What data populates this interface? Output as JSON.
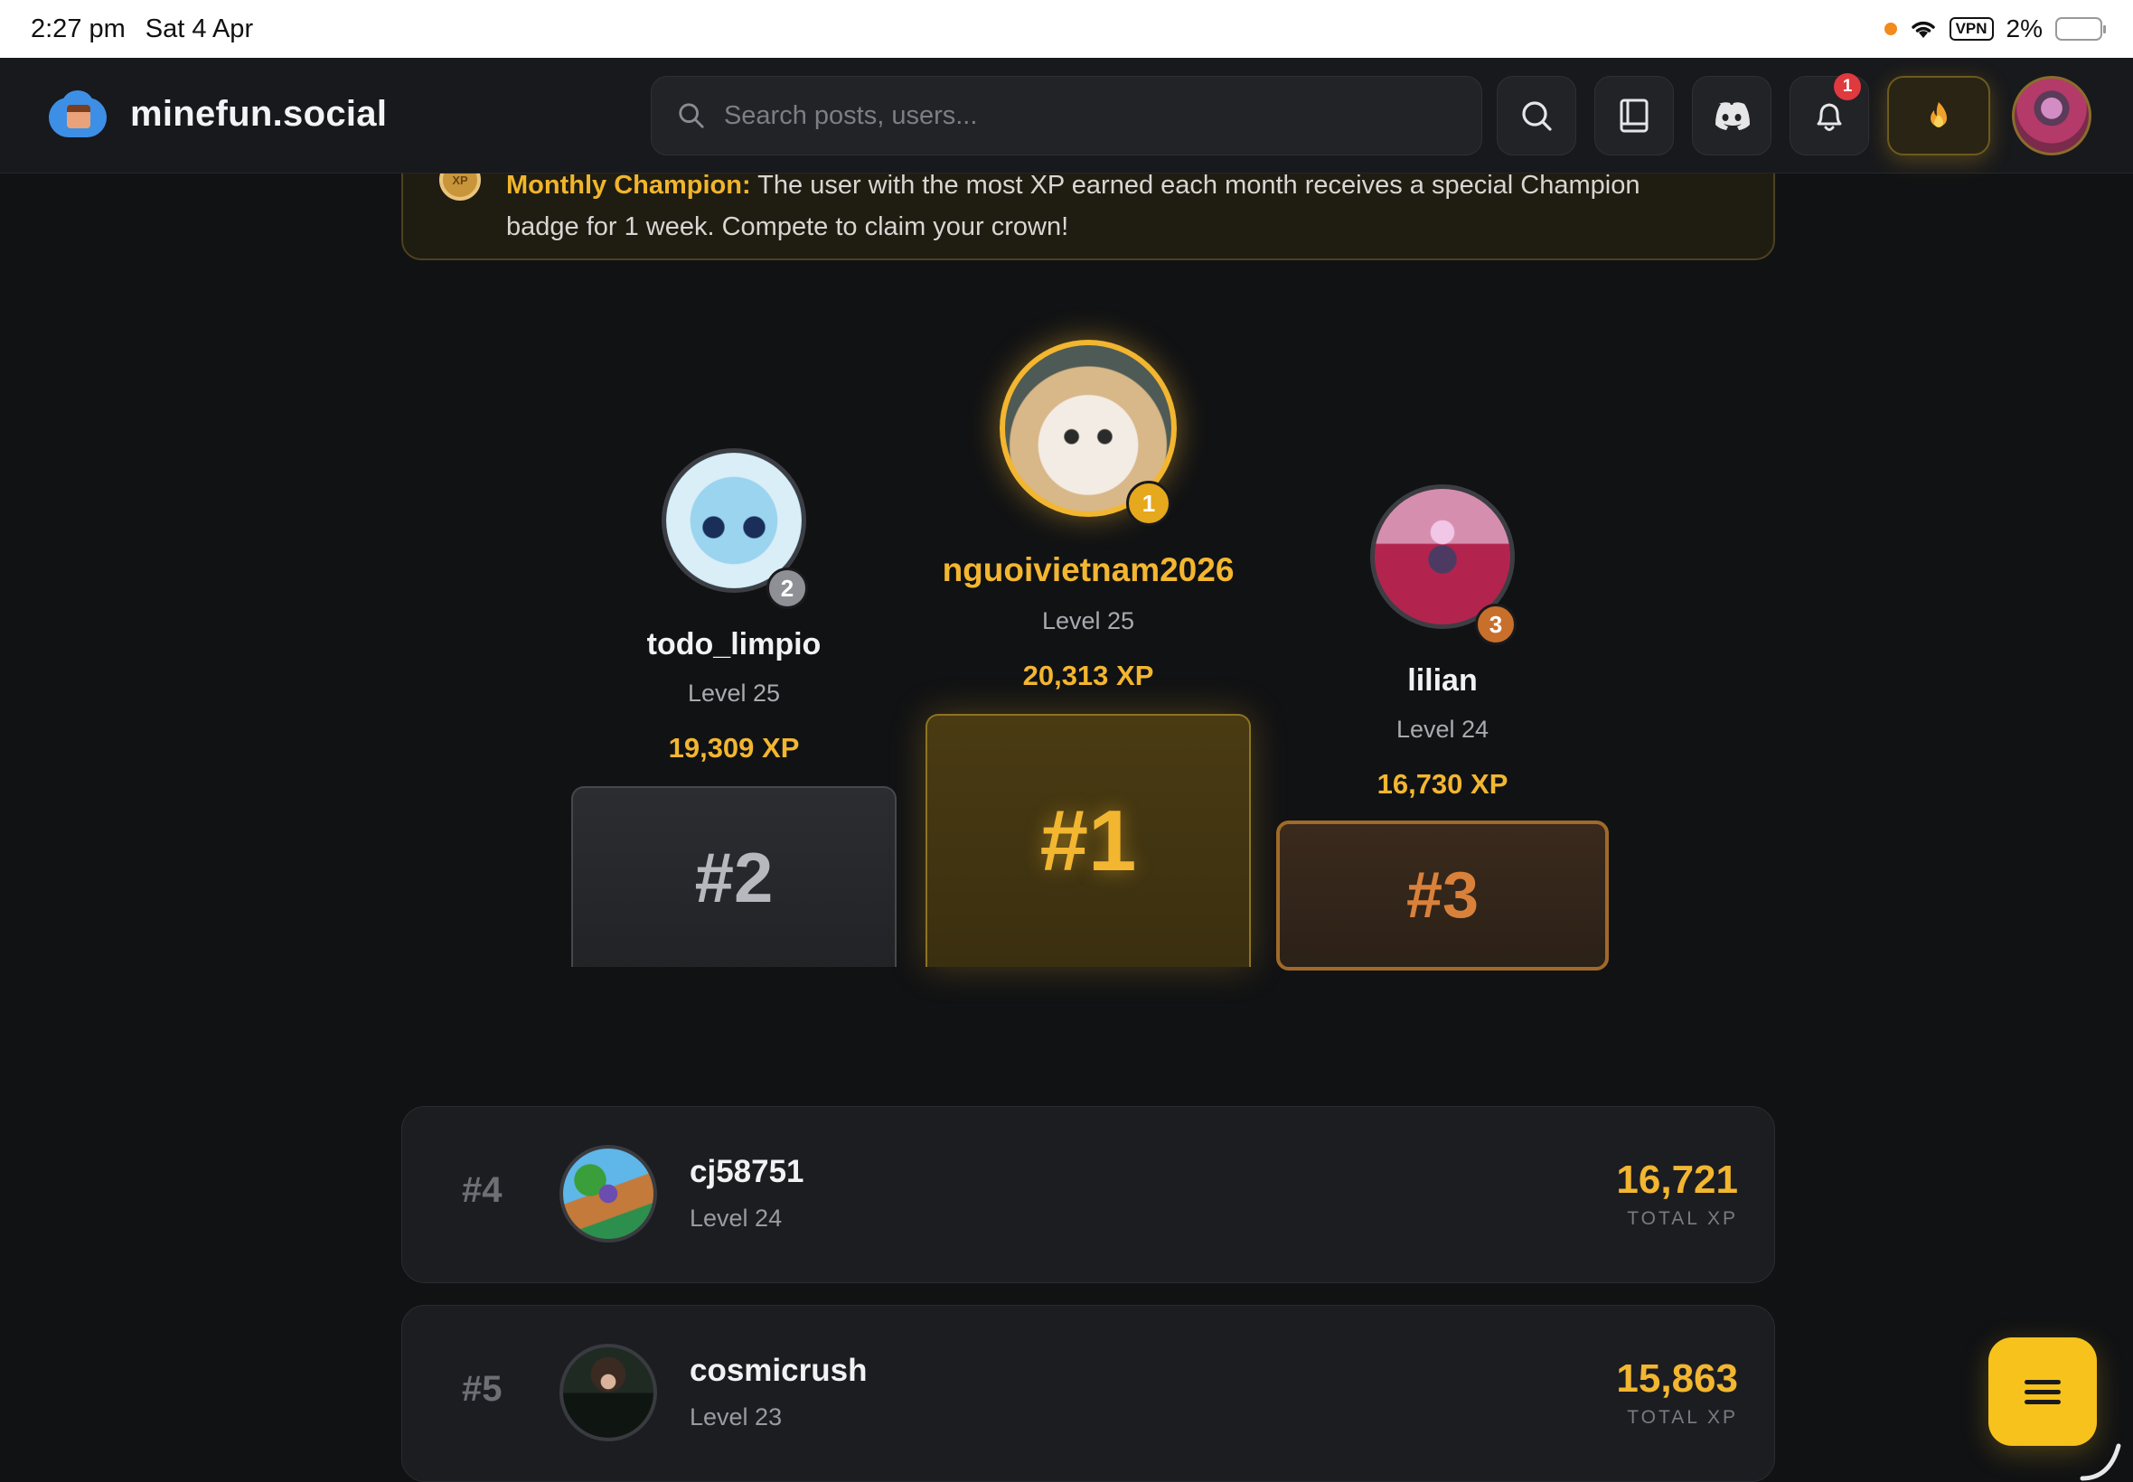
{
  "status_bar": {
    "time": "2:27 pm",
    "date": "Sat 4 Apr",
    "vpn": "VPN",
    "battery": "2%"
  },
  "nav": {
    "brand": "minefun.social",
    "search_placeholder": "Search posts, users...",
    "notification_count": "1",
    "icons": [
      "search-icon",
      "book-icon",
      "discord-icon",
      "bell-icon",
      "flame-icon"
    ]
  },
  "banner": {
    "highlight": "Monthly Champion:",
    "text": " The user with the most XP earned each month receives a special Champion badge for 1 week. Compete to claim your crown!"
  },
  "podium": {
    "first": {
      "rank_label": "#1",
      "medal": "1",
      "name": "nguoivietnam2026",
      "level": "Level 25",
      "xp": "20,313 XP"
    },
    "second": {
      "rank_label": "#2",
      "medal": "2",
      "name": "todo_limpio",
      "level": "Level 25",
      "xp": "19,309 XP"
    },
    "third": {
      "rank_label": "#3",
      "medal": "3",
      "name": "lilian",
      "level": "Level 24",
      "xp": "16,730 XP"
    }
  },
  "leaderboard": [
    {
      "rank": "#4",
      "name": "cj58751",
      "level": "Level 24",
      "xp": "16,721",
      "xp_label": "TOTAL XP"
    },
    {
      "rank": "#5",
      "name": "cosmicrush",
      "level": "Level 23",
      "xp": "15,863",
      "xp_label": "TOTAL XP"
    }
  ],
  "colors": {
    "accent_gold": "#f2b630",
    "silver": "#8e9096",
    "bronze": "#d9813a",
    "background": "#111214"
  }
}
